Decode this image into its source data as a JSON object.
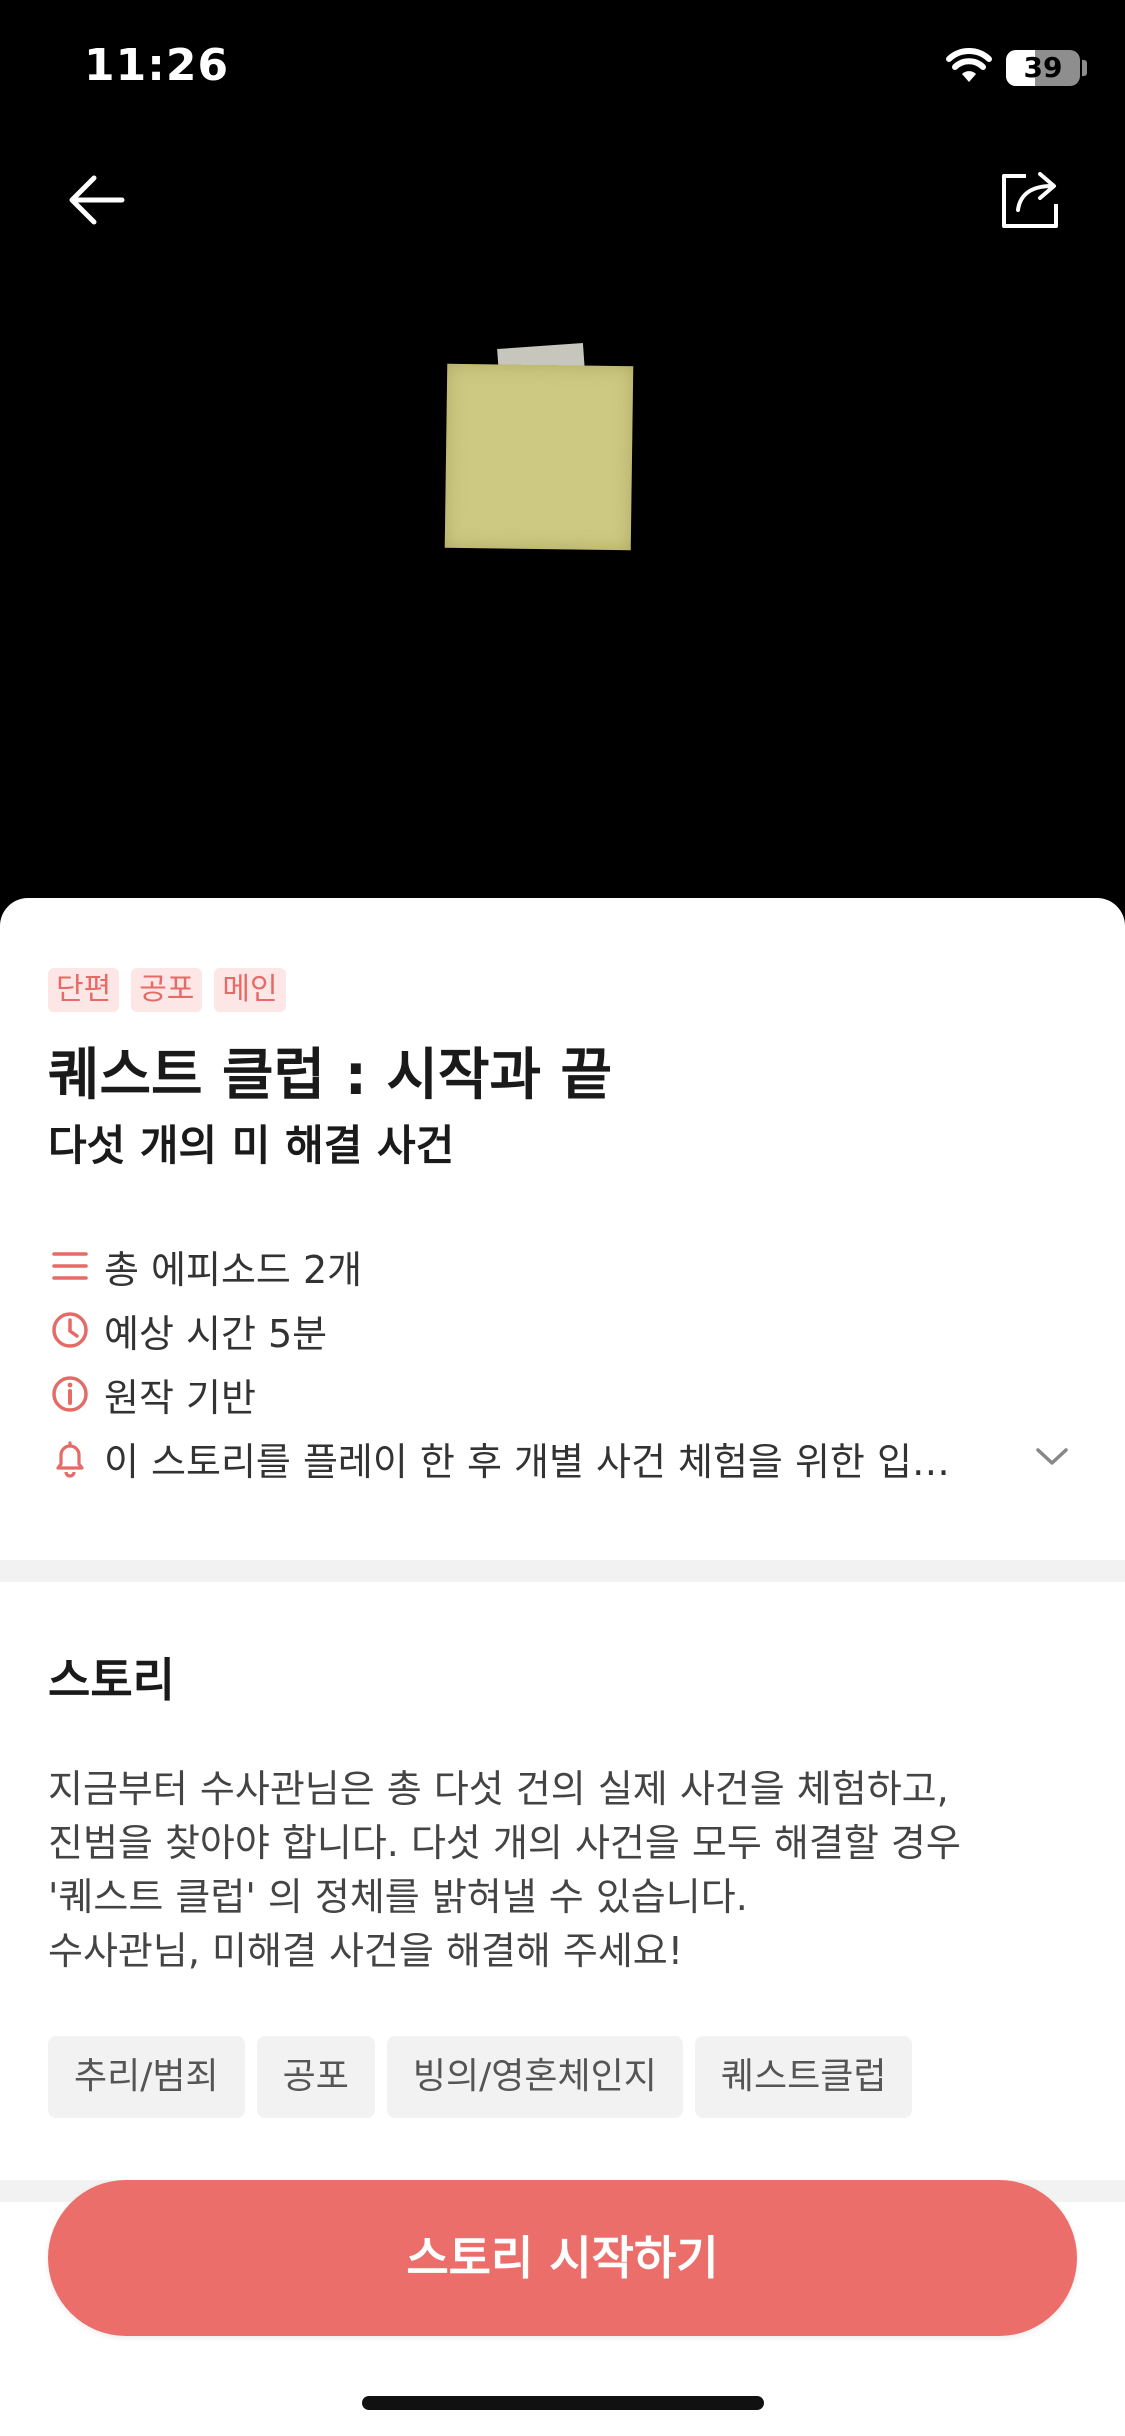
{
  "status_bar": {
    "time": "11:26",
    "battery": "39",
    "battery_level": 0.39
  },
  "header": {
    "back_icon": "arrow-left-icon",
    "share_icon": "share-icon"
  },
  "hero": {
    "image": "yellow-sticky-note"
  },
  "tags": [
    "단편",
    "공포",
    "메인"
  ],
  "title": "퀘스트 클럽 : 시작과 끝",
  "subtitle": "다섯 개의 미 해결 사건",
  "info": {
    "episodes": "총 에피소드 2개",
    "duration": "예상 시간 5분",
    "origin": "원작 기반",
    "notice": "이 스토리를 플레이 한 후 개별 사건 체험을 위한 입…"
  },
  "story_section": {
    "title": "스토리",
    "lines": [
      "지금부터 수사관님은 총 다섯 건의 실제 사건을 체험하고,",
      "진범을 찾아야 합니다. 다섯 개의 사건을 모두 해결할 경우",
      "'퀘스트 클럽' 의 정체를 밝혀낼 수 있습니다.",
      "수사관님, 미해결 사건을 해결해 주세요!"
    ]
  },
  "genres": [
    "추리/범죄",
    "공포",
    "빙의/영혼체인지",
    "퀘스트클럽"
  ],
  "cta": {
    "label": "스토리 시작하기"
  },
  "colors": {
    "accent": "#ec6e6b",
    "tag_bg": "#fde7e6",
    "chip_bg": "#f2f2f2"
  }
}
